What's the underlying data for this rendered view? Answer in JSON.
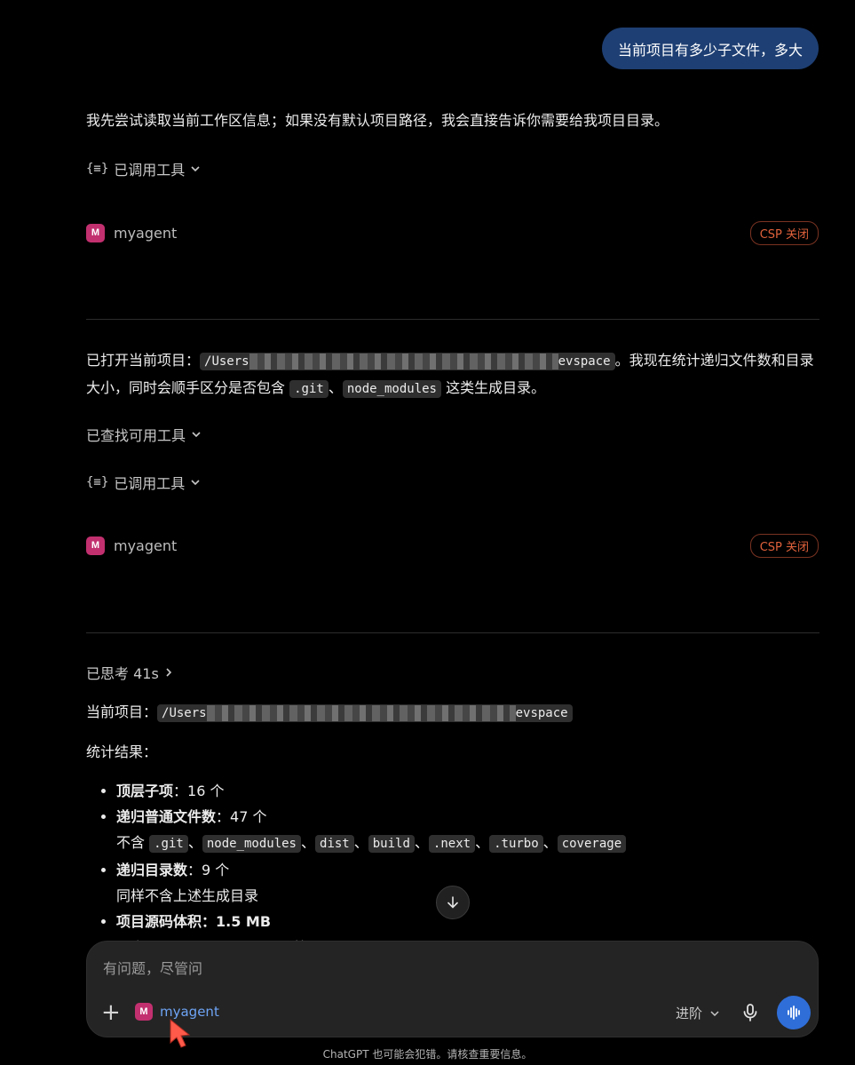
{
  "user_message": "当前项目有多少子文件，多大",
  "turn1": {
    "text": "我先尝试读取当前工作区信息；如果没有默认项目路径，我会直接告诉你需要给我项目目录。",
    "tools_label": "已调用工具",
    "agent_name": "myagent",
    "agent_initial": "M",
    "csp_label": "CSP 关闭"
  },
  "turn2": {
    "prefix": "已打开当前项目：",
    "path_start": "/Users",
    "path_end": "evspace",
    "text_mid": "。我现在统计递归文件数和目录大小，同时会顺手区分是否包含",
    "code_git": ".git",
    "sep": "、",
    "code_node": "node_modules",
    "text_end": "这类生成目录。",
    "search_tools_label": "已查找可用工具",
    "tools_label": "已调用工具",
    "agent_name": "myagent",
    "agent_initial": "M",
    "csp_label": "CSP 关闭"
  },
  "turn3": {
    "thought_label": "已思考 41s",
    "current_project_label": "当前项目：",
    "path_start": "/Users",
    "path_end": "evspace",
    "stats_label": "统计结果：",
    "items": [
      {
        "label": "顶层子项",
        "value": "：16 个"
      },
      {
        "label": "递归普通文件数",
        "value": "：47 个",
        "sub_prefix": "不含",
        "sub_codes": [
          ".git",
          "node_modules",
          "dist",
          "build",
          ".next",
          ".turbo",
          "coverage"
        ]
      },
      {
        "label": "递归目录数",
        "value": "：9 个",
        "sub": "同样不含上述生成目录"
      },
      {
        "label": "项目源码体积",
        "value": "：1.5 MB",
        "sub_partial": "不含 .git / node_modules 等"
      }
    ]
  },
  "composer": {
    "placeholder": "有问题，尽管问",
    "agent_name": "myagent",
    "agent_initial": "M",
    "level_label": "进阶"
  },
  "disclaimer": "ChatGPT 也可能会犯错。请核查重要信息。",
  "colors": {
    "user_bubble": "#1e3f73",
    "agent_badge": "#c2306f",
    "csp": "#e0613b",
    "voice_button": "#2f6ed8",
    "agent_link": "#6ea4f5"
  }
}
